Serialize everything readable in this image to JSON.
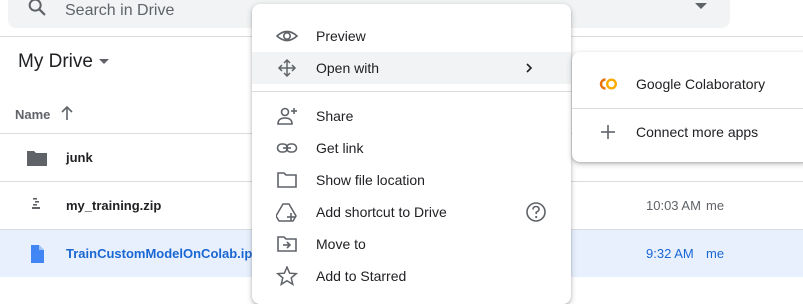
{
  "search": {
    "placeholder": "Search in Drive"
  },
  "drive": {
    "title": "My Drive"
  },
  "file_list": {
    "column_name": "Name",
    "rows": [
      {
        "name": "junk",
        "icon": "folder-icon",
        "modified": "",
        "owner": ""
      },
      {
        "name": "my_training.zip",
        "icon": "zip-file-icon",
        "modified": "10:03 AM",
        "owner": "me"
      },
      {
        "name": "TrainCustomModelOnColab.ipynb",
        "icon": "notebook-file-icon",
        "modified": "9:32 AM",
        "owner": "me",
        "selected": true
      }
    ]
  },
  "context_menu": {
    "items": [
      {
        "label": "Preview",
        "icon": "eye-icon"
      },
      {
        "label": "Open with",
        "icon": "move-arrows-icon",
        "has_submenu": true,
        "highlighted": true
      },
      {
        "label": "Share",
        "icon": "person-add-icon"
      },
      {
        "label": "Get link",
        "icon": "link-icon"
      },
      {
        "label": "Show file location",
        "icon": "folder-outline-icon"
      },
      {
        "label": "Add shortcut to Drive",
        "icon": "drive-shortcut-icon",
        "help": true
      },
      {
        "label": "Move to",
        "icon": "move-to-folder-icon"
      },
      {
        "label": "Add to Starred",
        "icon": "star-icon"
      }
    ]
  },
  "open_with_submenu": {
    "items": [
      {
        "label": "Google Colaboratory",
        "icon": "colab-logo-icon"
      },
      {
        "label": "Connect more apps",
        "icon": "plus-icon"
      }
    ]
  },
  "colors": {
    "selected_row_bg": "#e8f0fe",
    "selected_text": "#1967d2",
    "colab_orange": "#f9ab00",
    "colab_deep_orange": "#e8710a"
  }
}
